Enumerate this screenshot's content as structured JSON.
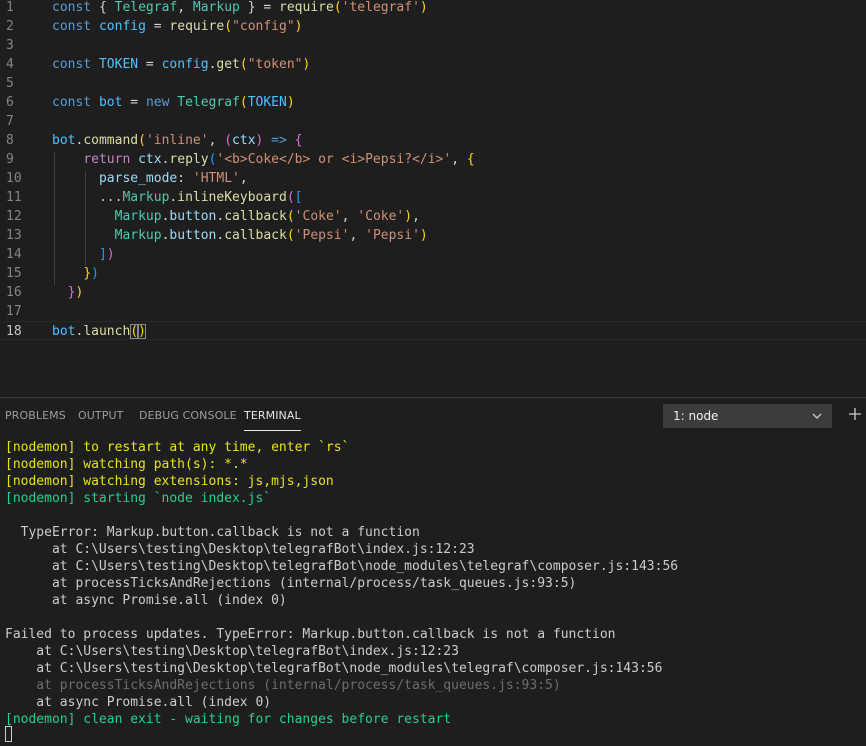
{
  "editor": {
    "current_line": 18,
    "lines": [
      {
        "n": "1",
        "tokens": [
          [
            "tk-kw",
            "const "
          ],
          [
            "tk-punc",
            "{ "
          ],
          [
            "tk-cls",
            "Telegraf"
          ],
          [
            "tk-punc",
            ", "
          ],
          [
            "tk-cls",
            "Markup"
          ],
          [
            "tk-punc",
            " } = "
          ],
          [
            "tk-fn",
            "require"
          ],
          [
            "tk-p1",
            "("
          ],
          [
            "tk-str",
            "'telegraf'"
          ],
          [
            "tk-p1",
            ")"
          ]
        ]
      },
      {
        "n": "2",
        "tokens": [
          [
            "tk-kw",
            "const "
          ],
          [
            "tk-var",
            "config"
          ],
          [
            "tk-op",
            " = "
          ],
          [
            "tk-fn",
            "require"
          ],
          [
            "tk-p1",
            "("
          ],
          [
            "tk-str",
            "\"config\""
          ],
          [
            "tk-p1",
            ")"
          ]
        ]
      },
      {
        "n": "3",
        "tokens": []
      },
      {
        "n": "4",
        "tokens": [
          [
            "tk-kw",
            "const "
          ],
          [
            "tk-const",
            "TOKEN"
          ],
          [
            "tk-op",
            " = "
          ],
          [
            "tk-var",
            "config"
          ],
          [
            "tk-punc",
            "."
          ],
          [
            "tk-fn",
            "get"
          ],
          [
            "tk-p1",
            "("
          ],
          [
            "tk-str",
            "\"token\""
          ],
          [
            "tk-p1",
            ")"
          ]
        ]
      },
      {
        "n": "5",
        "tokens": []
      },
      {
        "n": "6",
        "tokens": [
          [
            "tk-kw",
            "const "
          ],
          [
            "tk-var",
            "bot"
          ],
          [
            "tk-op",
            " = "
          ],
          [
            "tk-kw",
            "new "
          ],
          [
            "tk-cls",
            "Telegraf"
          ],
          [
            "tk-p1",
            "("
          ],
          [
            "tk-const",
            "TOKEN"
          ],
          [
            "tk-p1",
            ")"
          ]
        ]
      },
      {
        "n": "7",
        "tokens": []
      },
      {
        "n": "8",
        "tokens": [
          [
            "tk-var",
            "bot"
          ],
          [
            "tk-punc",
            "."
          ],
          [
            "tk-fn",
            "command"
          ],
          [
            "tk-p1",
            "("
          ],
          [
            "tk-str",
            "'inline'"
          ],
          [
            "tk-punc",
            ", "
          ],
          [
            "tk-p2",
            "("
          ],
          [
            "tk-prop",
            "ctx"
          ],
          [
            "tk-p2",
            ")"
          ],
          [
            "tk-kw",
            " => "
          ],
          [
            "tk-p2",
            "{"
          ]
        ]
      },
      {
        "n": "9",
        "tokens": [
          [
            "tk-punc",
            "    "
          ],
          [
            "tk-flow",
            "return "
          ],
          [
            "tk-prop",
            "ctx"
          ],
          [
            "tk-punc",
            "."
          ],
          [
            "tk-fn",
            "reply"
          ],
          [
            "tk-p3",
            "("
          ],
          [
            "tk-str",
            "'<b>Coke</b> or <i>Pepsi?</i>'"
          ],
          [
            "tk-punc",
            ", "
          ],
          [
            "tk-p1",
            "{"
          ]
        ]
      },
      {
        "n": "10",
        "tokens": [
          [
            "tk-punc",
            "      "
          ],
          [
            "tk-prop",
            "parse_mode"
          ],
          [
            "tk-punc",
            ": "
          ],
          [
            "tk-str",
            "'HTML'"
          ],
          [
            "tk-punc",
            ","
          ]
        ]
      },
      {
        "n": "11",
        "tokens": [
          [
            "tk-punc",
            "      ..."
          ],
          [
            "tk-cls",
            "Markup"
          ],
          [
            "tk-punc",
            "."
          ],
          [
            "tk-fn",
            "inlineKeyboard"
          ],
          [
            "tk-p2",
            "("
          ],
          [
            "tk-p3",
            "["
          ]
        ]
      },
      {
        "n": "12",
        "tokens": [
          [
            "tk-punc",
            "        "
          ],
          [
            "tk-cls",
            "Markup"
          ],
          [
            "tk-punc",
            "."
          ],
          [
            "tk-prop",
            "button"
          ],
          [
            "tk-punc",
            "."
          ],
          [
            "tk-fn",
            "callback"
          ],
          [
            "tk-p1",
            "("
          ],
          [
            "tk-str",
            "'Coke'"
          ],
          [
            "tk-punc",
            ", "
          ],
          [
            "tk-str",
            "'Coke'"
          ],
          [
            "tk-p1",
            ")"
          ],
          [
            "tk-punc",
            ","
          ]
        ]
      },
      {
        "n": "13",
        "tokens": [
          [
            "tk-punc",
            "        "
          ],
          [
            "tk-cls",
            "Markup"
          ],
          [
            "tk-punc",
            "."
          ],
          [
            "tk-prop",
            "button"
          ],
          [
            "tk-punc",
            "."
          ],
          [
            "tk-fn",
            "callback"
          ],
          [
            "tk-p1",
            "("
          ],
          [
            "tk-str",
            "'Pepsi'"
          ],
          [
            "tk-punc",
            ", "
          ],
          [
            "tk-str",
            "'Pepsi'"
          ],
          [
            "tk-p1",
            ")"
          ]
        ]
      },
      {
        "n": "14",
        "tokens": [
          [
            "tk-punc",
            "      "
          ],
          [
            "tk-p3",
            "]"
          ],
          [
            "tk-p2",
            ")"
          ]
        ]
      },
      {
        "n": "15",
        "tokens": [
          [
            "tk-punc",
            "    "
          ],
          [
            "tk-p1",
            "}"
          ],
          [
            "tk-p3",
            ")"
          ]
        ]
      },
      {
        "n": "16",
        "tokens": [
          [
            "tk-punc",
            "  "
          ],
          [
            "tk-p2",
            "}"
          ],
          [
            "tk-p1",
            ")"
          ]
        ]
      },
      {
        "n": "17",
        "tokens": []
      },
      {
        "n": "18",
        "tokens": [
          [
            "tk-var",
            "bot"
          ],
          [
            "tk-punc",
            "."
          ],
          [
            "tk-fn",
            "launch"
          ],
          [
            "tk-p1 bracket-match",
            "("
          ],
          [
            "tk-p1 bracket-match",
            ")"
          ]
        ]
      }
    ]
  },
  "panel": {
    "tabs": [
      {
        "label": "PROBLEMS",
        "active": false
      },
      {
        "label": "OUTPUT",
        "active": false
      },
      {
        "label": "DEBUG CONSOLE",
        "active": false
      },
      {
        "label": "TERMINAL",
        "active": true
      }
    ],
    "terminal_select": "1: node",
    "add_terminal_icon": "plus-icon",
    "select_chevron_icon": "chevron-down-icon"
  },
  "terminal": {
    "lines": [
      {
        "text": "[nodemon] to restart at any time, enter `rs`",
        "style": "term-yellow"
      },
      {
        "text": "[nodemon] watching path(s): *.*",
        "style": "term-yellow"
      },
      {
        "text": "[nodemon] watching extensions: js,mjs,json",
        "style": "term-yellow"
      },
      {
        "text": "[nodemon] starting `node index.js`",
        "style": "term-green"
      },
      {
        "text": "",
        "style": "term-white"
      },
      {
        "text": "  TypeError: Markup.button.callback is not a function",
        "style": "term-white"
      },
      {
        "text": "      at C:\\Users\\testing\\Desktop\\telegrafBot\\index.js:12:23",
        "style": "term-white"
      },
      {
        "text": "      at C:\\Users\\testing\\Desktop\\telegrafBot\\node_modules\\telegraf\\composer.js:143:56",
        "style": "term-white"
      },
      {
        "text": "      at processTicksAndRejections (internal/process/task_queues.js:93:5)",
        "style": "term-white"
      },
      {
        "text": "      at async Promise.all (index 0)",
        "style": "term-white"
      },
      {
        "text": "",
        "style": "term-white"
      },
      {
        "text": "Failed to process updates. TypeError: Markup.button.callback is not a function",
        "style": "term-white"
      },
      {
        "text": "    at C:\\Users\\testing\\Desktop\\telegrafBot\\index.js:12:23",
        "style": "term-white"
      },
      {
        "text": "    at C:\\Users\\testing\\Desktop\\telegrafBot\\node_modules\\telegraf\\composer.js:143:56",
        "style": "term-white"
      },
      {
        "text": "    at processTicksAndRejections (internal/process/task_queues.js:93:5)",
        "style": "term-dim"
      },
      {
        "text": "    at async Promise.all (index 0)",
        "style": "term-white"
      },
      {
        "text": "[nodemon] clean exit - waiting for changes before restart",
        "style": "term-green"
      }
    ]
  },
  "colors": {
    "background": "#1e1e1e",
    "terminal_yellow": "#e5e510",
    "terminal_green": "#23d18b",
    "terminal_text": "#cccccc"
  }
}
